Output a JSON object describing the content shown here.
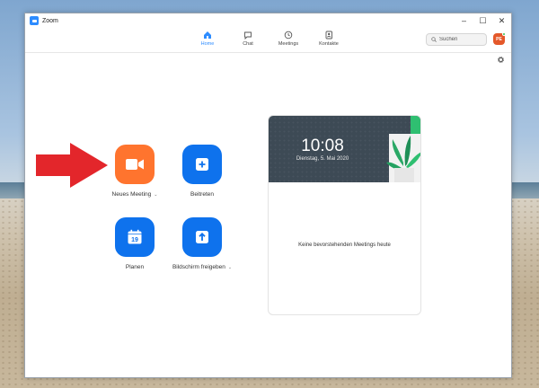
{
  "window": {
    "title": "Zoom",
    "controls": [
      "–",
      "☐",
      "✕"
    ]
  },
  "nav": {
    "tabs": [
      {
        "label": "Home",
        "icon": "home-icon",
        "active": true
      },
      {
        "label": "Chat",
        "icon": "chat-icon",
        "active": false
      },
      {
        "label": "Meetings",
        "icon": "clock-icon",
        "active": false
      },
      {
        "label": "Kontakte",
        "icon": "contacts-icon",
        "active": false
      }
    ],
    "search_placeholder": "Suchen",
    "avatar_initials": "PE"
  },
  "actions": {
    "new_meeting": "Neues Meeting",
    "join": "Beitreten",
    "schedule": "Planen",
    "schedule_day": "19",
    "share_screen": "Bildschirm freigeben"
  },
  "card": {
    "time": "10:08",
    "date": "Dienstag, 5. Mai 2020",
    "empty_message": "Keine bevorstehenden Meetings heute"
  },
  "colors": {
    "accent": "#2d8cff",
    "new_meeting": "#ff742e",
    "action_blue": "#0e72ed",
    "annotation_arrow": "#e3262b"
  }
}
